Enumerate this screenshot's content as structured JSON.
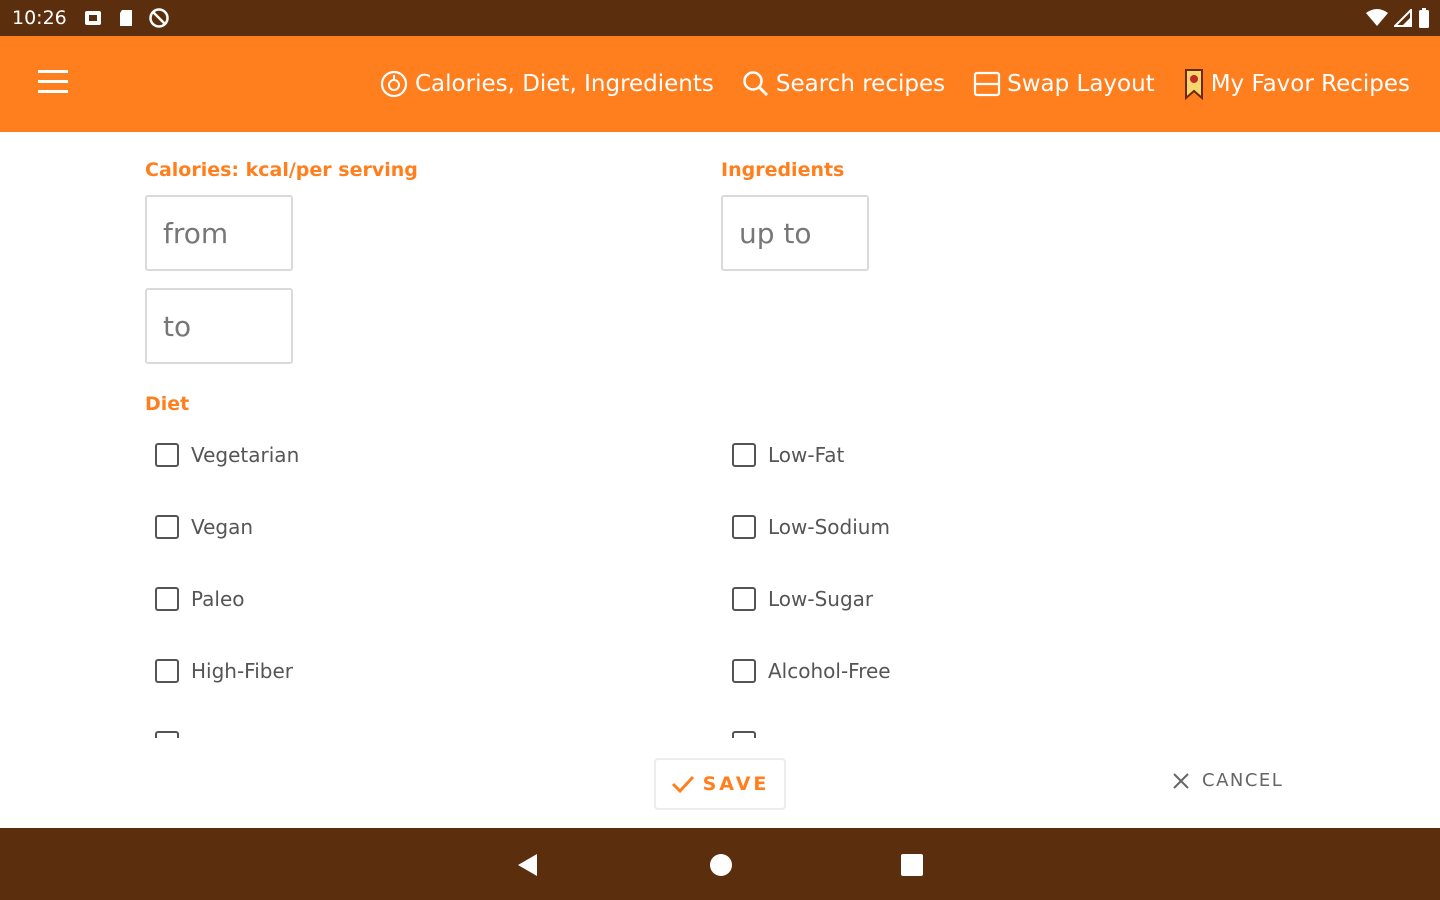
{
  "status_bar": {
    "time": "10:26"
  },
  "toolbar": {
    "actions": [
      {
        "label": "Calories, Diet, Ingredients",
        "icon": "ingredients-icon"
      },
      {
        "label": "Search recipes",
        "icon": "search-icon"
      },
      {
        "label": "Swap Layout",
        "icon": "swap-layout-icon"
      },
      {
        "label": "My Favor Recipes",
        "icon": "bookmark-icon"
      }
    ]
  },
  "calories": {
    "label": "Calories: kcal/per serving",
    "from_placeholder": "from",
    "to_placeholder": "to"
  },
  "ingredients": {
    "label": "Ingredients",
    "upto_placeholder": "up to"
  },
  "diet": {
    "label": "Diet",
    "left_options": [
      "Vegetarian",
      "Vegan",
      "Paleo",
      "High-Fiber"
    ],
    "right_options": [
      "Low-Fat",
      "Low-Sodium",
      "Low-Sugar",
      "Alcohol-Free"
    ]
  },
  "buttons": {
    "save": "SAVE",
    "cancel": "CANCEL"
  },
  "colors": {
    "accent": "#ff7f1f",
    "bars": "#5b2e0e"
  }
}
